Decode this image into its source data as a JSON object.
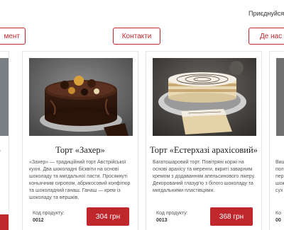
{
  "header": {
    "join_label": "Приєднуйся:"
  },
  "nav": {
    "left_label": "мент",
    "center_label": "Контакти",
    "right_label": "Де нас з"
  },
  "cards": [
    {
      "title": "Торт «Захер»",
      "description": "«Захер» — традиційний торт Австрійської кухні. Два шоколадні бісквіти на основі шоколаду та мигдальної пасти. Просякнуті коньячним сиропом, абрикосовий конфітюр та шоколадний ганаш. Ганаш — крем із шоколаду та вершків.",
      "code_label": "Код продукту:",
      "code": "0012",
      "price": "304 грн"
    },
    {
      "title": "Торт «Естерхазі арахісовий»",
      "description": "Багатошаровий торт. Повітряні коржі на основі арахісу та меренги, вкриті заварним кремом з додаванням апельсинового лікеру. Декорований глазур'ю з білого шоколаду та мигдальними пластівцями.",
      "code_label": "Код продукту:",
      "code": "0013",
      "price": "368 грн"
    }
  ],
  "right_card_fragments": {
    "desc_lines": [
      "Вишн",
      "пол",
      "пер",
      "шок",
      "сух"
    ],
    "code_fragment": "Ко",
    "code_value": "00"
  }
}
